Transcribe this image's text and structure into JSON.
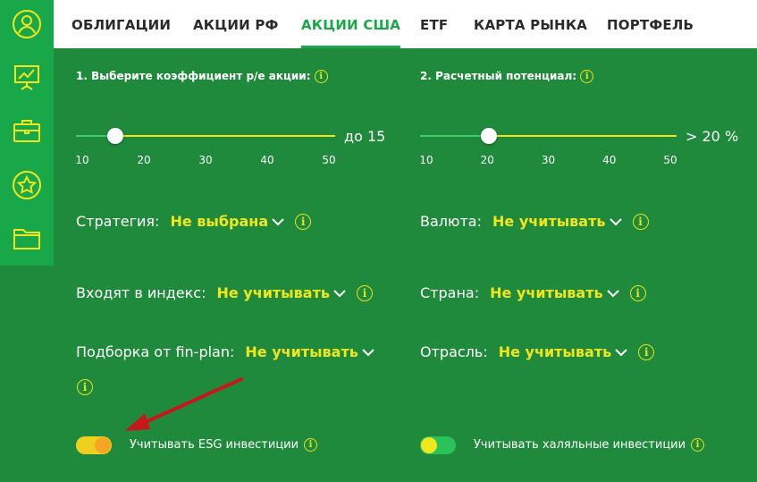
{
  "tabs": [
    "ОБЛИГАЦИИ",
    "АКЦИИ РФ",
    "АКЦИИ США",
    "ETF",
    "КАРТА РЫНКА",
    "ПОРТФЕЛЬ"
  ],
  "active_tab": "АКЦИИ США",
  "pe_slider": {
    "label": "1. Выберите коэффициент p/e акции:",
    "value_text": "до 15",
    "ticks": [
      "10",
      "20",
      "30",
      "40",
      "50"
    ],
    "min": 10,
    "max": 50,
    "value": 15
  },
  "potential_slider": {
    "label": "2. Расчетный потенциал:",
    "value_text": "> 20 %",
    "ticks": [
      "10",
      "20",
      "30",
      "40",
      "50"
    ],
    "min": 10,
    "max": 50,
    "value": 20
  },
  "filters": {
    "strategy": {
      "label": "Стратегия:",
      "value": "Не выбрана"
    },
    "currency": {
      "label": "Валюта:",
      "value": "Не учитывать"
    },
    "index": {
      "label": "Входят в индекс:",
      "value": "Не учитывать"
    },
    "country": {
      "label": "Страна:",
      "value": "Не учитывать"
    },
    "selection": {
      "label": "Подборка от fin-plan:",
      "value": "Не учитывать"
    },
    "industry": {
      "label": "Отрасль:",
      "value": "Не учитывать"
    }
  },
  "toggles": {
    "esg": {
      "label": "Учитывать ESG инвестиции",
      "on": true
    },
    "halal": {
      "label": "Учитывать халяльные инвестиции",
      "on": false
    }
  },
  "info_glyph": "i",
  "colors": {
    "background": "#1f8a3c",
    "sidebar": "#18a84a",
    "accent_green": "#18a84a",
    "value_yellow": "#f0e61e",
    "toggle_on": "#f5a623",
    "annotation_arrow": "#c8161d"
  },
  "icons": {
    "sidebar": [
      "user-icon",
      "presentation-chart-icon",
      "briefcase-icon",
      "star-icon",
      "folder-icon"
    ]
  }
}
